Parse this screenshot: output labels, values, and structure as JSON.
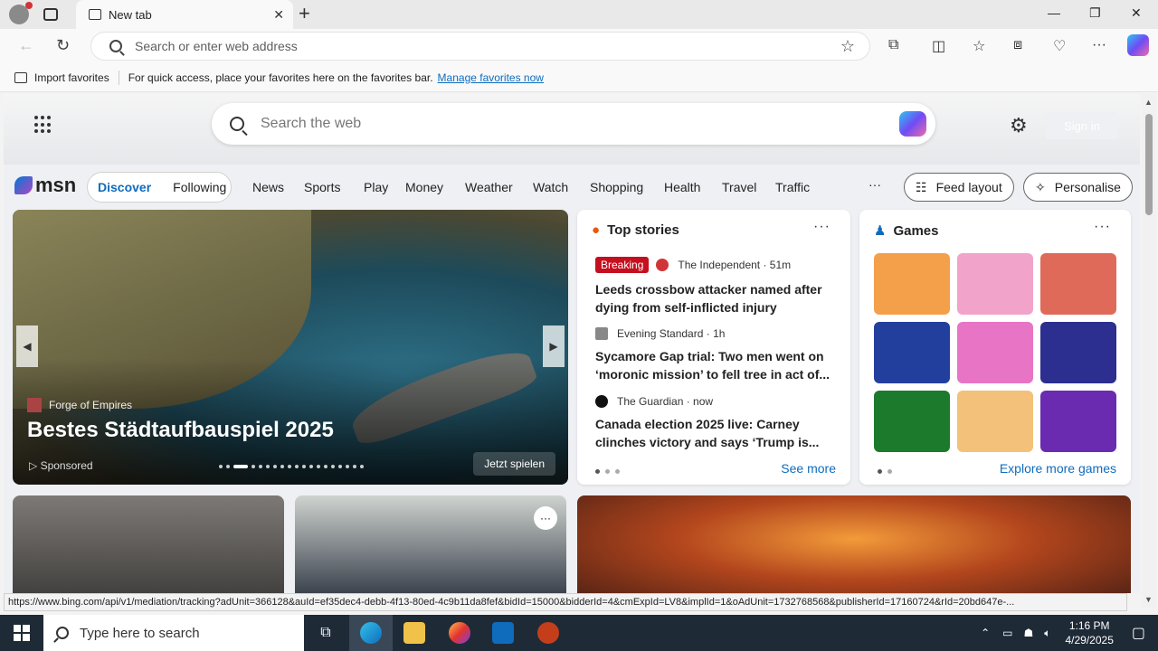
{
  "browser": {
    "tab_title": "New tab",
    "address_placeholder": "Search or enter web address",
    "favorites": {
      "import_label": "Import favorites",
      "hint": "For quick access, place your favorites here on the favorites bar.",
      "manage_link": "Manage favorites now"
    },
    "status_url": "https://www.bing.com/api/v1/mediation/tracking?adUnit=366128&auId=ef35dec4-debb-4f13-80ed-4c9b11da8fef&bidId=15000&bidderId=4&cmExpId=LV8&implId=1&oAdUnit=1732768568&publisherId=17160724&rId=20bd647e-..."
  },
  "msn": {
    "search_placeholder": "Search the web",
    "signin_label": "Sign in",
    "logo_text": "msn",
    "feed_tabs": [
      "Discover",
      "Following"
    ],
    "nav": [
      "News",
      "Sports",
      "Play",
      "Money",
      "Weather",
      "Watch",
      "Shopping",
      "Health",
      "Travel",
      "Traffic"
    ],
    "more_label": "···",
    "feed_layout_label": "Feed layout",
    "personalise_label": "Personalise"
  },
  "hero": {
    "brand": "Forge of Empires",
    "title": "Bestes Städtaufbauspiel 2025",
    "sponsored": "Sponsored",
    "cta": "Jetzt spielen"
  },
  "top_stories": {
    "title": "Top stories",
    "items": [
      {
        "badge": "Breaking",
        "source": "The Independent · 51m",
        "headline": "Leeds crossbow attacker named after dying from self-inflicted injury"
      },
      {
        "badge": "",
        "source": "Evening Standard · 1h",
        "headline": "Sycamore Gap trial: Two men went on ‘moronic mission’ to fell tree in act of..."
      },
      {
        "badge": "",
        "source": "The Guardian · now",
        "headline": "Canada election 2025 live: Carney clinches victory and says ‘Trump is..."
      }
    ],
    "see_more": "See more"
  },
  "games": {
    "title": "Games",
    "explore": "Explore more games",
    "tile_colors": [
      "#f4a04b",
      "#f2a3c9",
      "#e06a5a",
      "#233f9e",
      "#e874c5",
      "#2c2f8f",
      "#1c7a2c",
      "#f3c17a",
      "#6a2bb0"
    ]
  },
  "taskbar": {
    "search_placeholder": "Type here to search",
    "time": "1:16 PM",
    "date": "4/29/2025"
  }
}
